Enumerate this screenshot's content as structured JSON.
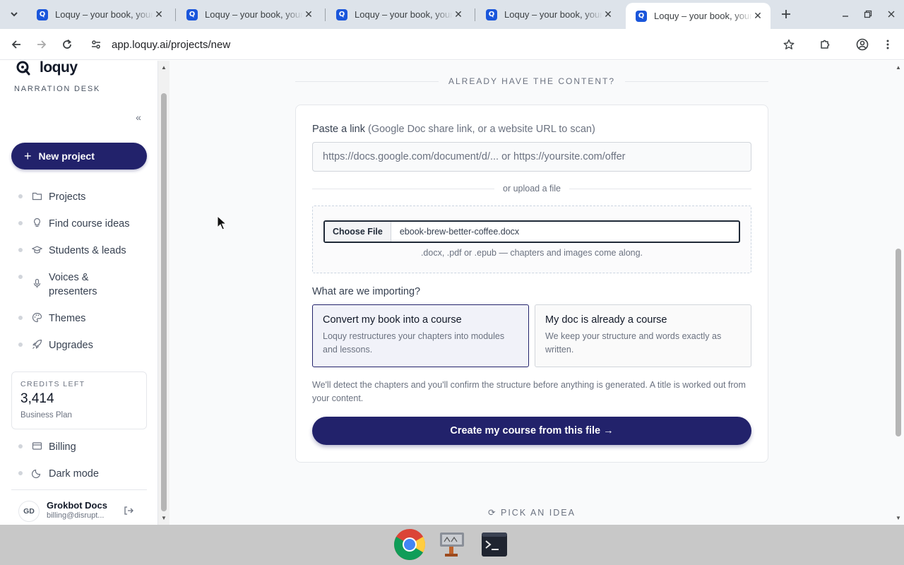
{
  "browser": {
    "tabs": [
      {
        "title": "Loquy – your book, your course",
        "active": false
      },
      {
        "title": "Loquy – your book, your course",
        "active": false
      },
      {
        "title": "Loquy – your book, your course",
        "active": false
      },
      {
        "title": "Loquy – your book, your course",
        "active": false
      },
      {
        "title": "Loquy – your book, your course",
        "active": true
      }
    ],
    "favicon_letter": "Q",
    "url": "app.loquy.ai/projects/new"
  },
  "sidebar": {
    "brand": "loquy",
    "subtitle": "NARRATION DESK",
    "collapse_glyph": "«",
    "new_project_label": "New project",
    "nav": [
      {
        "label": "Projects",
        "icon": "folder-icon"
      },
      {
        "label": "Find course ideas",
        "icon": "lightbulb-icon"
      },
      {
        "label": "Students & leads",
        "icon": "graduation-cap-icon"
      },
      {
        "label": "Voices & presenters",
        "icon": "microphone-icon"
      },
      {
        "label": "Themes",
        "icon": "palette-icon"
      },
      {
        "label": "Upgrades",
        "icon": "rocket-icon"
      }
    ],
    "credits": {
      "label": "CREDITS LEFT",
      "value": "3,414",
      "plan": "Business Plan"
    },
    "bottom_nav": [
      {
        "label": "Billing",
        "icon": "credit-card-icon"
      },
      {
        "label": "Dark mode",
        "icon": "moon-icon"
      }
    ],
    "user": {
      "initials": "GD",
      "name": "Grokbot Docs",
      "email": "billing@disrupt..."
    }
  },
  "main": {
    "section_heading": "ALREADY HAVE THE CONTENT?",
    "link_label": "Paste a link",
    "link_hint": "(Google Doc share link, or a website URL to scan)",
    "link_placeholder": "https://docs.google.com/document/d/... or https://yoursite.com/offer",
    "upload_divider": "or upload a file",
    "choose_file_label": "Choose File",
    "file_name": "ebook-brew-better-coffee.docx",
    "upload_hint": ".docx, .pdf or .epub — chapters and images come along.",
    "import_question": "What are we importing?",
    "options": [
      {
        "title": "Convert my book into a course",
        "desc": "Loquy restructures your chapters into modules and lessons.",
        "selected": true
      },
      {
        "title": "My doc is already a course",
        "desc": "We keep your structure and words exactly as written.",
        "selected": false
      }
    ],
    "note": "We'll detect the chapters and you'll confirm the structure before anything is generated. A title is worked out from your content.",
    "create_button": "Create my course from this file →",
    "pick_idea": "PICK AN IDEA",
    "pick_idea_glyph": "⟳"
  },
  "colors": {
    "accent": "#22226b",
    "favicon": "#1a56db"
  }
}
